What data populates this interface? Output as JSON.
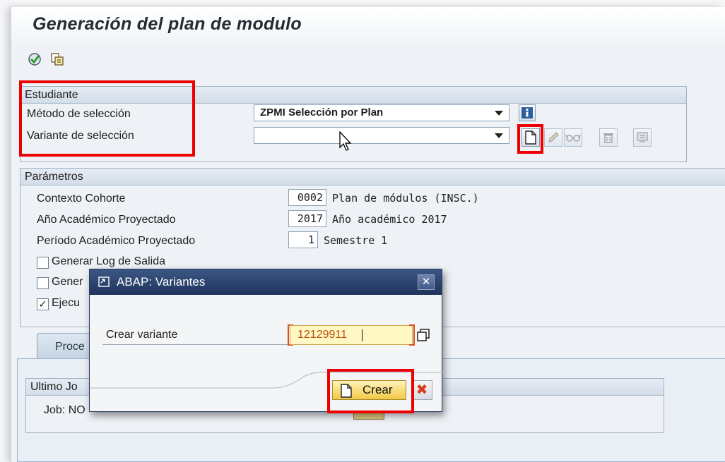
{
  "window": {
    "title": "Generación del plan de modulo"
  },
  "toolbar": {
    "execute_icon": "execute-icon",
    "copy_icon": "copy-icon"
  },
  "estudiante": {
    "heading": "Estudiante",
    "metodo_label": "Método de selección",
    "metodo_value": "ZPMI Selección por Plan",
    "variante_label": "Variante de selección",
    "variante_value": ""
  },
  "parametros": {
    "heading": "Parámetros",
    "rows": [
      {
        "label": "Contexto Cohorte",
        "code": "0002",
        "text": "Plan de módulos (INSC.)"
      },
      {
        "label": "Año Académico Proyectado",
        "code": "2017",
        "text": "Año académico 2017"
      },
      {
        "label": "Período Académico Proyectado",
        "code": "1",
        "text": "Semestre 1"
      }
    ],
    "checks": [
      {
        "label": "Generar Log de Salida",
        "checked": false
      },
      {
        "label": "Gener",
        "checked": false
      },
      {
        "label": "Ejecu",
        "checked": true
      }
    ]
  },
  "tabs": {
    "proc_label": "Proce"
  },
  "job_group": {
    "heading": "Ultimo Jo",
    "text": "Job: NO"
  },
  "dialog": {
    "title": "ABAP: Variantes",
    "field_label": "Crear variante",
    "field_value": "12129911",
    "create_label": "Crear",
    "close_glyph": "✕",
    "cancel_glyph": "✖"
  },
  "colors": {
    "highlight": "#ee0000",
    "dialog_title": "#2b4470",
    "input_bg": "#fff7c4"
  }
}
